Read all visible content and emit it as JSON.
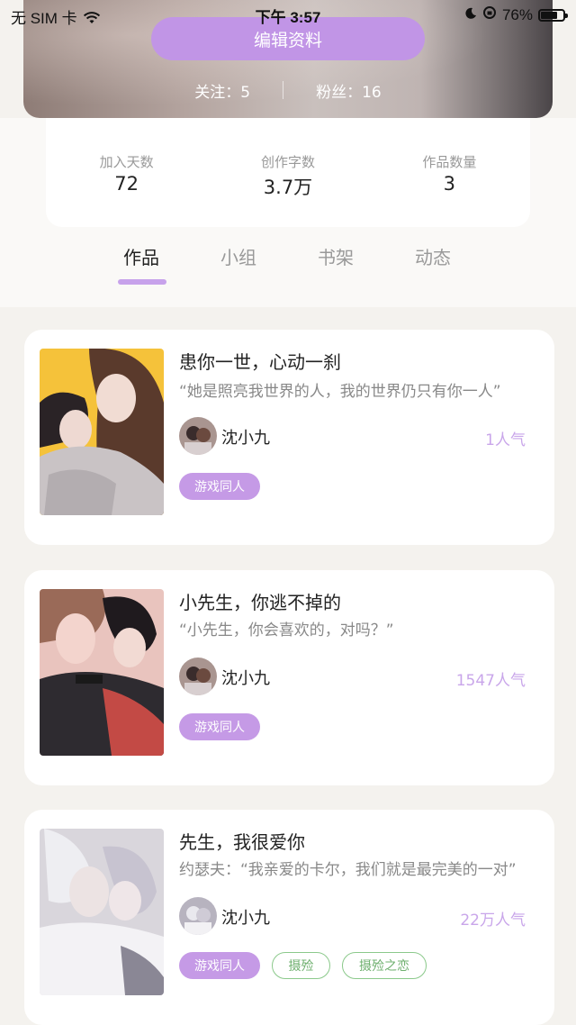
{
  "status_bar": {
    "carrier": "无 SIM 卡",
    "time": "下午 3:57",
    "battery": "76%",
    "battery_level": 0.76
  },
  "profile": {
    "edit_label": "编辑资料",
    "following": "关注：5",
    "followers": "粉丝：16"
  },
  "stats": [
    {
      "label": "加入天数",
      "value": "72"
    },
    {
      "label": "创作字数",
      "value": "3.7万"
    },
    {
      "label": "作品数量",
      "value": "3"
    }
  ],
  "tabs": [
    {
      "label": "作品",
      "active": true
    },
    {
      "label": "小组",
      "active": false
    },
    {
      "label": "书架",
      "active": false
    },
    {
      "label": "动态",
      "active": false
    }
  ],
  "works": [
    {
      "title": "患你一世，心动一刹",
      "desc": "“她是照亮我世界的人，我的世界仍只有你一人”",
      "author": "沈小九",
      "popularity": "1人气",
      "tags": [
        "游戏同人"
      ]
    },
    {
      "title": "小先生，你逃不掉的",
      "desc": "“小先生，你会喜欢的，对吗？”",
      "author": "沈小九",
      "popularity": "1547人气",
      "tags": [
        "游戏同人"
      ]
    },
    {
      "title": "先生，我很爱你",
      "desc": "约瑟夫：“我亲爱的卡尔，我们就是最完美的一对”",
      "author": "沈小九",
      "popularity": "22万人气",
      "tags": [
        "游戏同人",
        "摄殓",
        "摄殓之恋"
      ]
    }
  ],
  "colors": {
    "accent": "#c195e6",
    "popularity": "#c9a6ea",
    "tag_green": "#6fb06f"
  }
}
